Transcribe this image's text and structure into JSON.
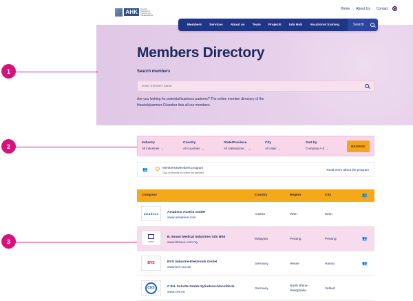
{
  "header": {
    "logo_text": "AHK",
    "logo_subtext": "Deutsch-Malaysische Industrie- und Handelskammer",
    "util_links": [
      "Home",
      "About Us",
      "Contact"
    ],
    "nav_items": [
      "Members",
      "Services",
      "About us",
      "Team",
      "Projects",
      "Info Hub",
      "Vocational training"
    ],
    "search_label": "Search"
  },
  "hero": {
    "title": "Members Directory",
    "search_heading": "Search members",
    "search_placeholder": "Enter member name",
    "description": "Are you looking for potential business partners? The online member directory of the Handelskammer Chamber lists all our members."
  },
  "markers": [
    "1",
    "2",
    "3"
  ],
  "filters": {
    "industry": {
      "label": "Industry",
      "value": "All industries"
    },
    "country": {
      "label": "Country",
      "value": "All countries"
    },
    "state": {
      "label": "State/Province",
      "value": "All states/provi..."
    },
    "city": {
      "label": "City",
      "value": "All cities"
    },
    "sort": {
      "label": "Sort by",
      "value": "Company A-Z"
    },
    "browse_label": "BROWSE"
  },
  "program": {
    "title": "Members4Members program",
    "note": "Click on Browse to confirm the selection",
    "link": "Read more about the program"
  },
  "table": {
    "headers": [
      "Company",
      "Country",
      "Region",
      "City"
    ],
    "rows": [
      {
        "logo": "amadeus",
        "name": "Amadeus Austria GmbH",
        "web": "www.amadeus.com",
        "country": "Austria",
        "region": "Wien",
        "city": "Wien"
      },
      {
        "logo": "LOGO",
        "name": "B. Braun Medical Industries Sdn Bhd",
        "web": "www.bbraun.com.my",
        "country": "Malaysia",
        "region": "Penang",
        "city": "Penang"
      },
      {
        "logo": "BVS",
        "name": "BVS Industrie-Elektronik GmbH",
        "web": "www.bvs-cnc.de",
        "country": "Germany",
        "region": "Hesse",
        "city": "Hanau"
      },
      {
        "logo": "CES",
        "name": "C.Ed. Schulte GmbH Zylinderschlossfabrik",
        "web": "www.ces.eu",
        "country": "Germany",
        "region": "North Rhine-Westphalia",
        "city": "Velbert"
      }
    ]
  }
}
